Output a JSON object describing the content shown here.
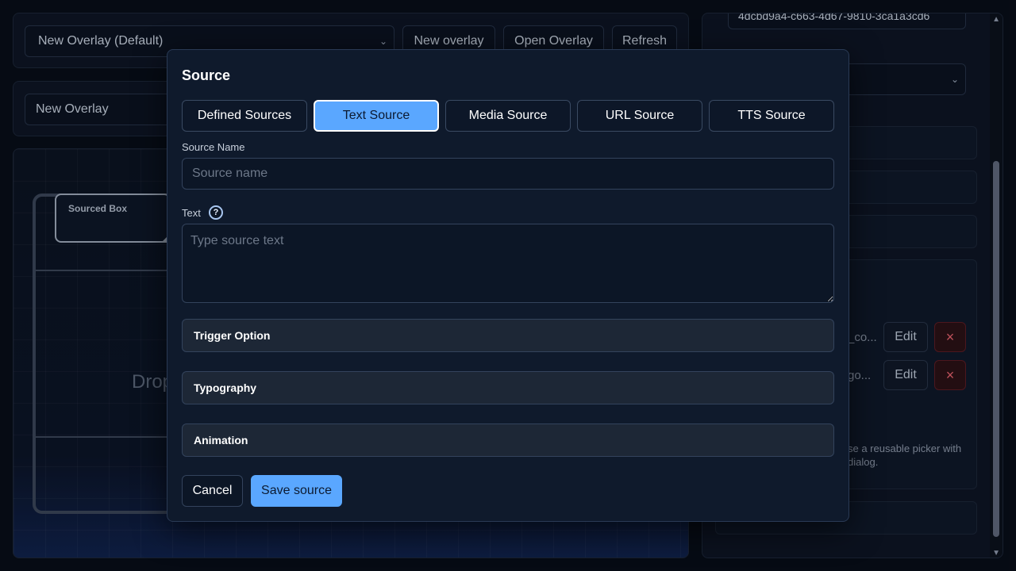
{
  "toolbar": {
    "overlay_select_value": "New Overlay (Default)",
    "new_overlay_label": "New overlay",
    "open_overlay_label": "Open Overlay",
    "refresh_label": "Refresh"
  },
  "overlay_name_value": "New Overlay",
  "canvas": {
    "sourced_box_label": "Sourced Box",
    "drop_text": "Drop"
  },
  "right_panel": {
    "id_value": "4dcbd9a4-c663-4d67-9810-3ca1a3cd6",
    "item1_text": "_co...",
    "item2_text": "go...",
    "edit_label": "Edit",
    "delete_symbol": "×",
    "help_line1": "se a reusable picker with",
    "help_line2": "dialog."
  },
  "modal": {
    "title": "Source",
    "tabs": [
      {
        "label": "Defined Sources",
        "active": false
      },
      {
        "label": "Text Source",
        "active": true
      },
      {
        "label": "Media Source",
        "active": false
      },
      {
        "label": "URL Source",
        "active": false
      },
      {
        "label": "TTS Source",
        "active": false
      }
    ],
    "source_name_label": "Source Name",
    "source_name_placeholder": "Source name",
    "text_label": "Text",
    "help_symbol": "?",
    "text_placeholder": "Type source text",
    "sections": [
      "Trigger Option",
      "Typography",
      "Animation"
    ],
    "cancel_label": "Cancel",
    "save_label": "Save source"
  },
  "colors": {
    "accent": "#5aa7ff",
    "background": "#080d18",
    "modal_bg": "#0f1a2c",
    "danger": "#e0606c"
  }
}
